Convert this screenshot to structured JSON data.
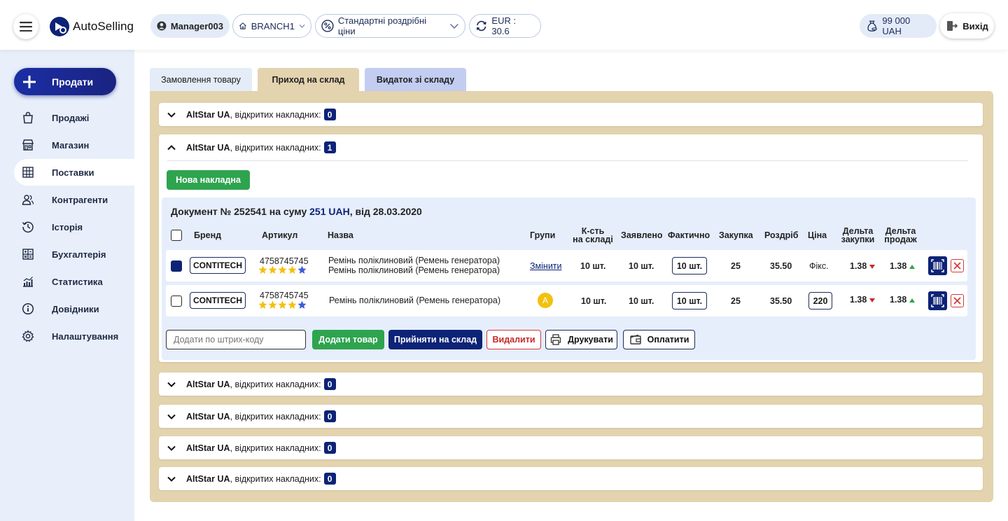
{
  "header": {
    "logo_text": "AutoSelling",
    "user": "Manager003",
    "branch": "BRANCH1",
    "price_type": "Стандартні роздрібні ціни",
    "currency": "EUR : 30.6",
    "balance": "99 000 UAH",
    "exit_label": "Вихід"
  },
  "sidebar": {
    "sell_label": "Продати",
    "items": [
      {
        "label": "Продажі",
        "icon": "bag-icon"
      },
      {
        "label": "Магазин",
        "icon": "store-icon"
      },
      {
        "label": "Поставки",
        "icon": "delivery-icon",
        "active": true
      },
      {
        "label": "Контрагенти",
        "icon": "users-icon"
      },
      {
        "label": "Історія",
        "icon": "history-icon"
      },
      {
        "label": "Бухгалтерія",
        "icon": "accounting-icon"
      },
      {
        "label": "Статистика",
        "icon": "stats-icon"
      },
      {
        "label": "Довідники",
        "icon": "info-icon"
      },
      {
        "label": "Налаштування",
        "icon": "gear-icon"
      }
    ]
  },
  "tabs": [
    "Замовлення товару",
    "Приход на склад",
    "Видаток зі складу"
  ],
  "accordions": [
    {
      "supplier": "AltStar UA",
      "text": ", відкритих накладних:",
      "count": "0"
    },
    {
      "supplier": "AltStar UA",
      "text": ", відкритих накладних:",
      "count": "1"
    },
    {
      "supplier": "AltStar UA",
      "text": ", відкритих накладних:",
      "count": "0"
    },
    {
      "supplier": "AltStar UA",
      "text": ", відкритих накладних:",
      "count": "0"
    },
    {
      "supplier": "AltStar UA",
      "text": ", відкритих накладних:",
      "count": "0"
    },
    {
      "supplier": "AltStar UA",
      "text": ", відкритих накладних:",
      "count": "0"
    }
  ],
  "new_invoice_label": "Нова накладна",
  "document": {
    "title_prefix": "Документ № 252541 на суму ",
    "amount": "251 UAH",
    "title_suffix": ", від 28.03.2020",
    "columns": {
      "brand": "Бренд",
      "article": "Артикул",
      "name": "Назва",
      "groups": "Групи",
      "stock_l1": "К-сть",
      "stock_l2": "на складі",
      "declared": "Заявлено",
      "actual": "Фактично",
      "purchase": "Закупка",
      "retail": "Роздріб",
      "price": "Ціна",
      "dp_l1": "Дельта",
      "dp_l2": "закупки",
      "ds_l1": "Дельта",
      "ds_l2": "продаж"
    },
    "rows": [
      {
        "checked": true,
        "brand": "CONTITECH",
        "article": "4758745745",
        "rating": 4,
        "name_l1": "Ремінь поліклиновий (Ремень генератора)",
        "name_l2": "Ремінь поліклиновий (Ремень генератора)",
        "group": "Змінити",
        "stock": "10 шт.",
        "declared": "10 шт.",
        "actual": "10 шт.",
        "purchase": "25",
        "retail": "35.50",
        "price": "Фікс.",
        "delta_purchase": "1.38",
        "delta_sale": "1.38"
      },
      {
        "checked": false,
        "brand": "CONTITECH",
        "article": "4758745745",
        "rating": 4,
        "name_l1": "Ремінь поліклиновий (Ремень генератора)",
        "group": "A",
        "stock": "10 шт.",
        "declared": "10 шт.",
        "actual": "10 шт.",
        "purchase": "25",
        "retail": "35.50",
        "price": "220",
        "delta_purchase": "1.38",
        "delta_sale": "1.38"
      }
    ],
    "barcode_placeholder": "Додати по штрих-коду",
    "actions": {
      "add": "Додати товар",
      "accept": "Прийняти на склад",
      "delete": "Видалити",
      "print": "Друкувати",
      "pay": "Оплатити"
    }
  },
  "colors": {
    "primary": "#0d2377",
    "green": "#2ea44f",
    "danger": "#d13a3a",
    "panel": "#e3d3ae",
    "sidebar": "#e8effa",
    "star_yellow": "#f2c10f",
    "star_blue": "#3d5bd9"
  }
}
